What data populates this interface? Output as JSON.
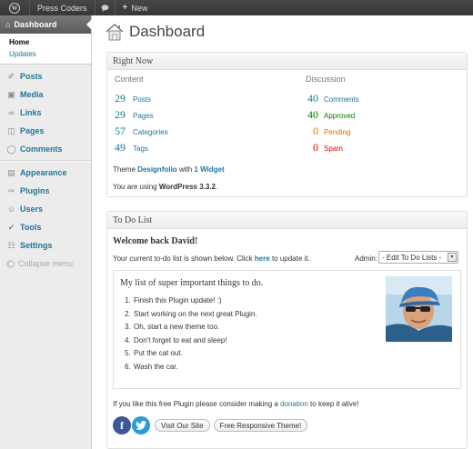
{
  "adminbar": {
    "site_name": "Press Coders",
    "new_label": "+ New",
    "new_plus": "+",
    "new_text": "New"
  },
  "sidebar": {
    "dashboard_label": "Dashboard",
    "sub_home": "Home",
    "sub_updates": "Updates",
    "items": [
      {
        "label": "Posts",
        "icon": "pin-icon"
      },
      {
        "label": "Media",
        "icon": "media-icon"
      },
      {
        "label": "Links",
        "icon": "links-icon"
      },
      {
        "label": "Pages",
        "icon": "pages-icon"
      },
      {
        "label": "Comments",
        "icon": "comments-icon"
      },
      {
        "label": "Appearance",
        "icon": "appearance-icon"
      },
      {
        "label": "Plugins",
        "icon": "plugins-icon"
      },
      {
        "label": "Users",
        "icon": "users-icon"
      },
      {
        "label": "Tools",
        "icon": "tools-icon"
      },
      {
        "label": "Settings",
        "icon": "settings-icon"
      }
    ],
    "collapse_label": "Collapse menu"
  },
  "page": {
    "title": "Dashboard"
  },
  "right_now": {
    "title": "Right Now",
    "content_heading": "Content",
    "discussion_heading": "Discussion",
    "content": [
      {
        "count": "29",
        "label": "Posts"
      },
      {
        "count": "29",
        "label": "Pages"
      },
      {
        "count": "57",
        "label": "Categories"
      },
      {
        "count": "49",
        "label": "Tags"
      }
    ],
    "discussion": [
      {
        "count": "40",
        "label": "Comments",
        "color": "#21759b"
      },
      {
        "count": "40",
        "label": "Approved",
        "color": "#008000"
      },
      {
        "count": "0",
        "label": "Pending",
        "color": "#e66f00"
      },
      {
        "count": "0",
        "label": "Spam",
        "color": "#dd0000"
      }
    ],
    "theme_prefix": "Theme",
    "theme_name": "Designfolio",
    "theme_with": "with",
    "widget_count": "1 Widget",
    "version_prefix": "You are using",
    "version": "WordPress 3.3.2",
    "version_suffix": "."
  },
  "todo": {
    "title": "To Do List",
    "welcome": "Welcome back David!",
    "current_prefix": "Your current to-do list is shown below. Click",
    "here": "here",
    "current_suffix": "to update it.",
    "admin_label": "Admin:",
    "select_value": "- Edit To Do Lists -",
    "list_title": "My list of super important things to do.",
    "items": [
      "Finish this Plugin update! :)",
      "Start working on the next great Plugin.",
      "Oh, start a new theme too.",
      "Don't forget to eat and sleep!",
      "Put the cat out.",
      "Wash the car."
    ],
    "donate_prefix": "If you like this free Plugin please consider making a",
    "donate_link": "donation",
    "donate_suffix": "to keep it alive!",
    "visit_site": "Visit Our Site",
    "free_theme": "Free Responsive Theme!"
  },
  "colors": {
    "link": "#21759b",
    "adminbar": "#464646",
    "sidebar": "#ececec"
  }
}
